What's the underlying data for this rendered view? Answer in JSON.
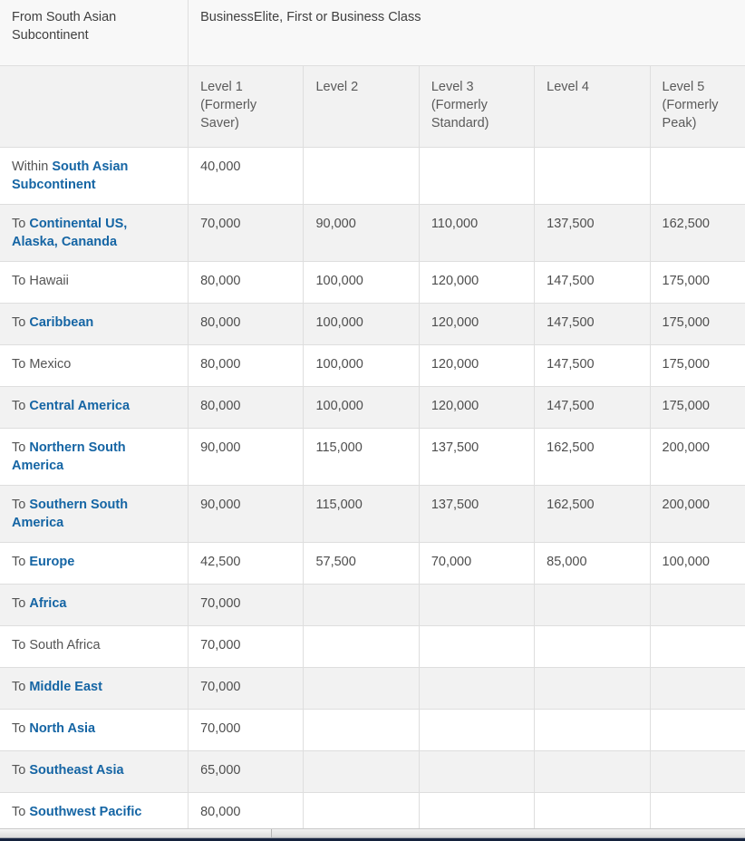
{
  "table": {
    "origin_header": "From South Asian Subcontinent",
    "cabin_header": "BusinessElite, First or Business Class",
    "blank_header": "",
    "level_columns": [
      "Level 1 (Formerly Saver)",
      "Level 2",
      "Level 3 (Formerly Standard)",
      "Level 4",
      "Level 5 (Formerly Peak)"
    ],
    "link_color": "#1565a4",
    "rows": [
      {
        "prefix": "Within ",
        "destination": "South Asian Subcontinent",
        "is_link": true,
        "lines": 2,
        "values": [
          "40,000",
          "",
          "",
          "",
          ""
        ]
      },
      {
        "prefix": "To ",
        "destination": "Continental US, Alaska, Cananda",
        "is_link": true,
        "lines": 2,
        "values": [
          "70,000",
          "90,000",
          "110,000",
          "137,500",
          "162,500"
        ]
      },
      {
        "prefix": "To ",
        "destination": "Hawaii",
        "is_link": false,
        "lines": 1,
        "values": [
          "80,000",
          "100,000",
          "120,000",
          "147,500",
          "175,000"
        ]
      },
      {
        "prefix": "To ",
        "destination": "Caribbean",
        "is_link": true,
        "lines": 1,
        "values": [
          "80,000",
          "100,000",
          "120,000",
          "147,500",
          "175,000"
        ]
      },
      {
        "prefix": "To ",
        "destination": "Mexico",
        "is_link": false,
        "lines": 1,
        "values": [
          "80,000",
          "100,000",
          "120,000",
          "147,500",
          "175,000"
        ]
      },
      {
        "prefix": "To ",
        "destination": "Central America",
        "is_link": true,
        "lines": 1,
        "values": [
          "80,000",
          "100,000",
          "120,000",
          "147,500",
          "175,000"
        ]
      },
      {
        "prefix": "To ",
        "destination": "Northern South America",
        "is_link": true,
        "lines": 2,
        "values": [
          "90,000",
          "115,000",
          "137,500",
          "162,500",
          "200,000"
        ]
      },
      {
        "prefix": "To ",
        "destination": "Southern South America",
        "is_link": true,
        "lines": 2,
        "values": [
          "90,000",
          "115,000",
          "137,500",
          "162,500",
          "200,000"
        ]
      },
      {
        "prefix": "To ",
        "destination": "Europe",
        "is_link": true,
        "lines": 1,
        "values": [
          "42,500",
          "57,500",
          "70,000",
          "85,000",
          "100,000"
        ]
      },
      {
        "prefix": "To ",
        "destination": "Africa",
        "is_link": true,
        "lines": 1,
        "values": [
          "70,000",
          "",
          "",
          "",
          ""
        ]
      },
      {
        "prefix": "To ",
        "destination": "South Africa",
        "is_link": false,
        "lines": 1,
        "values": [
          "70,000",
          "",
          "",
          "",
          ""
        ]
      },
      {
        "prefix": "To ",
        "destination": "Middle East",
        "is_link": true,
        "lines": 1,
        "values": [
          "70,000",
          "",
          "",
          "",
          ""
        ]
      },
      {
        "prefix": "To ",
        "destination": "North Asia",
        "is_link": true,
        "lines": 1,
        "values": [
          "70,000",
          "",
          "",
          "",
          ""
        ]
      },
      {
        "prefix": "To ",
        "destination": "Southeast Asia",
        "is_link": true,
        "lines": 1,
        "values": [
          "65,000",
          "",
          "",
          "",
          ""
        ]
      },
      {
        "prefix": "To ",
        "destination": "Southwest Pacific",
        "is_link": true,
        "lines": 1,
        "values": [
          "80,000",
          "",
          "",
          "",
          ""
        ]
      }
    ]
  }
}
